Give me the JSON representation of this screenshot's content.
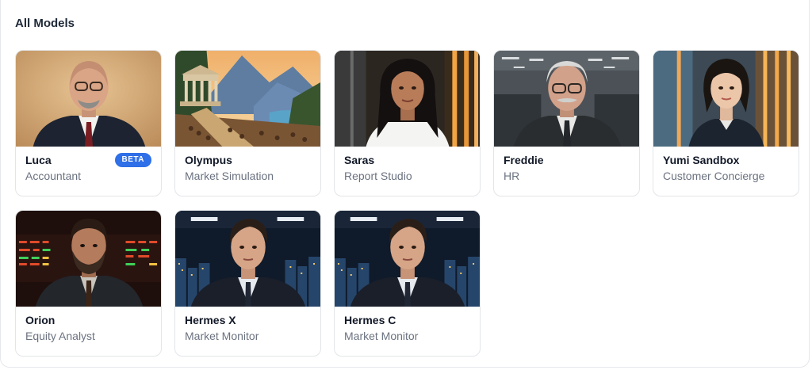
{
  "section": {
    "title": "All Models"
  },
  "cards": [
    {
      "name": "Luca",
      "subtitle": "Accountant",
      "badge": "BETA",
      "image": "portrait-bald-man-glasses"
    },
    {
      "name": "Olympus",
      "subtitle": "Market Simulation",
      "image": "greek-temple-landscape"
    },
    {
      "name": "Saras",
      "subtitle": "Report Studio",
      "image": "portrait-woman-office"
    },
    {
      "name": "Freddie",
      "subtitle": "HR",
      "image": "portrait-elderly-man-office"
    },
    {
      "name": "Yumi Sandbox",
      "subtitle": "Customer Concierge",
      "image": "portrait-woman-lobby"
    },
    {
      "name": "Orion",
      "subtitle": "Equity Analyst",
      "image": "portrait-bearded-man-stock-board"
    },
    {
      "name": "Hermes X",
      "subtitle": "Market Monitor",
      "image": "portrait-man-city-night"
    },
    {
      "name": "Hermes C",
      "subtitle": "Market Monitor",
      "image": "portrait-man-city-night"
    }
  ],
  "colors": {
    "badge": "#2f6fe8",
    "title_text": "#1f2937",
    "subtitle_text": "#6b7280",
    "card_border": "#e3e5e8"
  }
}
